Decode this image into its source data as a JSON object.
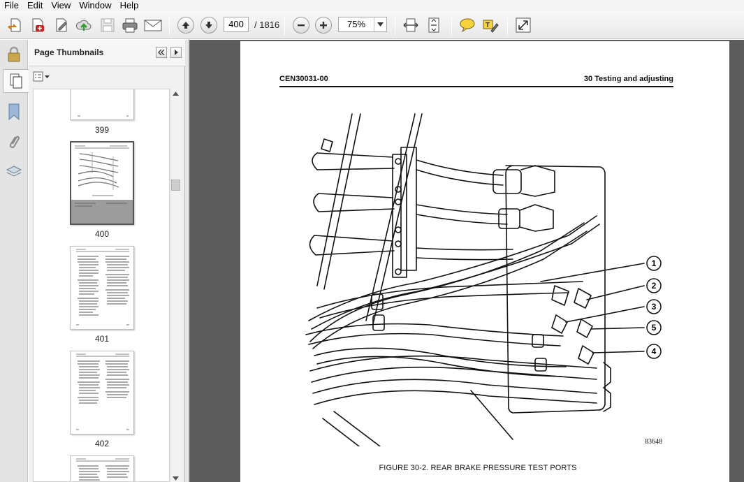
{
  "menu": {
    "items": [
      "File",
      "Edit",
      "View",
      "Window",
      "Help"
    ]
  },
  "toolbar": {
    "page_current": "400",
    "page_total": "/ 1816",
    "zoom": "75%"
  },
  "thumbnails": {
    "title": "Page Thumbnails",
    "pages": [
      "399",
      "400",
      "401",
      "402"
    ],
    "selected": "400"
  },
  "document": {
    "header_left": "CEN30031-00",
    "header_right": "30 Testing and adjusting",
    "figure_number": "83648",
    "figure_caption": "FIGURE 30-2. REAR BRAKE PRESSURE TEST PORTS",
    "callouts": [
      "1",
      "2",
      "3",
      "5",
      "4"
    ]
  },
  "colors": {
    "doc_background": "#5c5c5c",
    "toolbar": "#eeeeee",
    "panel": "#f0f0f0"
  }
}
